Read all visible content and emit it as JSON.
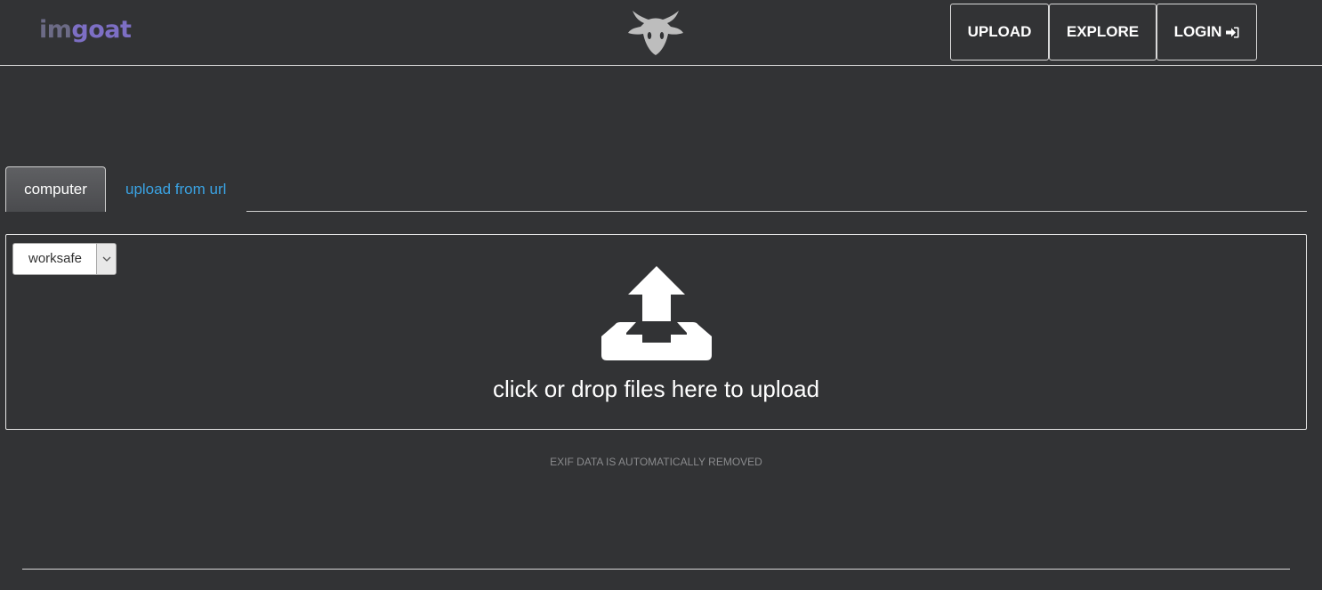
{
  "header": {
    "logo_im": "im",
    "logo_goat": "goat",
    "mascot_icon": "goat-head-icon",
    "nav": {
      "upload": "UPLOAD",
      "explore": "EXPLORE",
      "login": "LOGIN",
      "login_icon": "sign-in-icon"
    }
  },
  "tabs": {
    "computer": "computer",
    "url": "upload from url"
  },
  "dropzone": {
    "rating_select": {
      "value": "worksafe"
    },
    "icon": "upload-inbox-icon",
    "text": "click or drop files here to upload"
  },
  "note": "EXIF DATA IS AUTOMATICALLY REMOVED",
  "colors": {
    "background": "#323335",
    "logo_im": "#6c6b86",
    "logo_goat": "#7d6fc4",
    "link": "#3aa3e3",
    "muted_text": "#8a8b8d"
  }
}
